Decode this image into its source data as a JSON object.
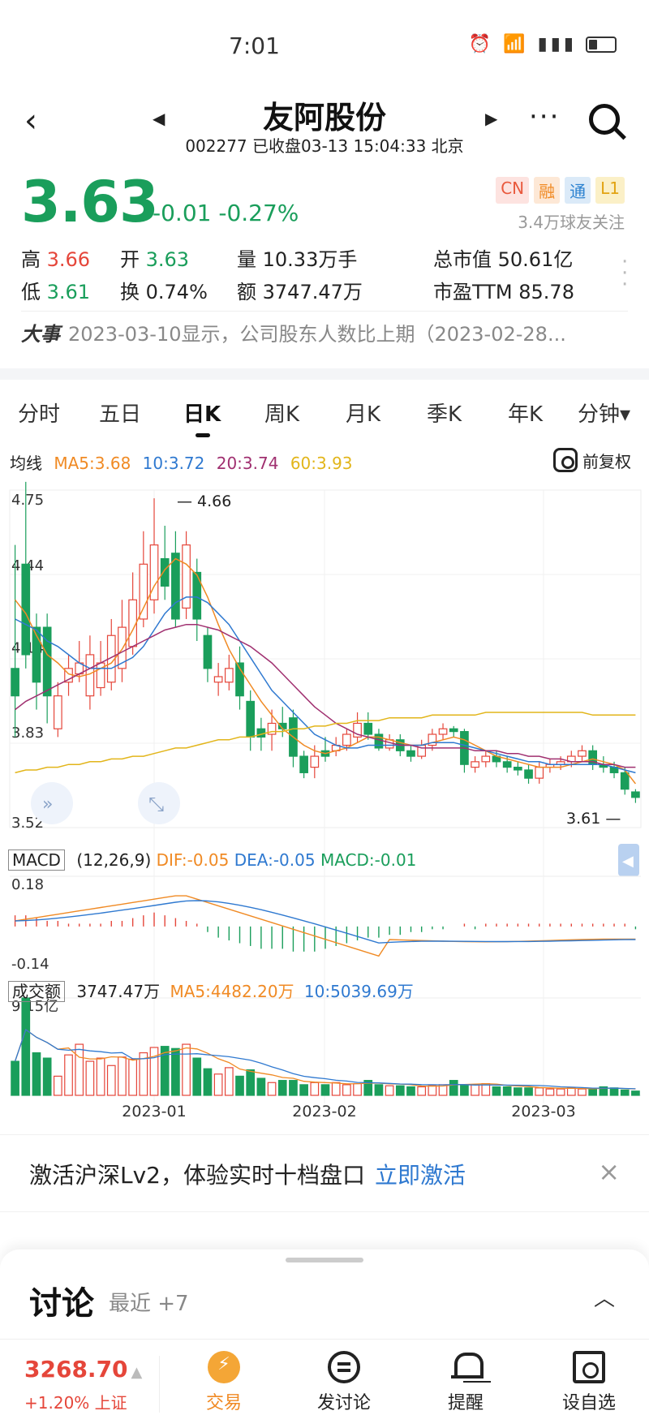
{
  "status_bar": {
    "time": "7:01",
    "icons_text": "⏰ 6 📶 4G ▮"
  },
  "nav": {
    "title": "友阿股份",
    "subtitle": "002277 已收盘03-13 15:04:33 北京",
    "more": "···"
  },
  "quote": {
    "price": "3.63",
    "change": "-0.01 -0.27%",
    "badges": [
      "CN",
      "融",
      "通",
      "L1"
    ],
    "followers": "3.4万球友关注"
  },
  "stats": [
    {
      "label": "高",
      "value": "3.66",
      "tone": "red"
    },
    {
      "label": "开",
      "value": "3.63",
      "tone": "green"
    },
    {
      "label": "量",
      "value": "10.33万手",
      "tone": "plain"
    },
    {
      "label": "总市值",
      "value": "50.61亿",
      "tone": "plain"
    },
    {
      "label": "低",
      "value": "3.61",
      "tone": "green"
    },
    {
      "label": "换",
      "value": "0.74%",
      "tone": "plain"
    },
    {
      "label": "额",
      "value": "3747.47万",
      "tone": "plain"
    },
    {
      "label": "市盈TTM",
      "value": "85.78",
      "tone": "plain"
    }
  ],
  "event": {
    "label": "大事",
    "text": "2023-03-10显示，公司股东人数比上期（2023-02-28..."
  },
  "tabs": [
    "分时",
    "五日",
    "日K",
    "周K",
    "月K",
    "季K",
    "年K",
    "分钟▾"
  ],
  "active_tab": 2,
  "ma": {
    "label": "均线",
    "items": [
      {
        "text": "MA5:3.68",
        "color": "#f08a24"
      },
      {
        "text": "10:3.72",
        "color": "#2f79d0"
      },
      {
        "text": "20:3.74",
        "color": "#a03070"
      },
      {
        "text": "60:3.93",
        "color": "#e2b51a"
      }
    ],
    "adjust": "前复权"
  },
  "macd": {
    "tag": "MACD",
    "params": "(12,26,9)",
    "dif": "DIF:-0.05",
    "dea": "DEA:-0.05",
    "macd": "MACD:-0.01",
    "ymax": "0.18",
    "ymin": "-0.14"
  },
  "volume": {
    "tag": "成交额",
    "value": "3747.47万",
    "ma5": "MA5:4482.20万",
    "ma10": "10:5039.69万",
    "ymax": "9.15亿"
  },
  "chart_data": {
    "type": "candlestick",
    "y_ticks": [
      "4.75",
      "4.44",
      "4.14",
      "3.83",
      "3.52"
    ],
    "ylim": [
      3.52,
      4.75
    ],
    "x_ticks": [
      "2023-01",
      "2023-02",
      "2023-03"
    ],
    "high_label": "4.66",
    "low_label": "3.61",
    "candles": [
      [
        4.1,
        4.0,
        4.55,
        3.85
      ],
      [
        4.48,
        4.15,
        4.78,
        4.1
      ],
      [
        4.25,
        4.05,
        4.3,
        3.95
      ],
      [
        4.25,
        4.0,
        4.3,
        3.9
      ],
      [
        3.88,
        4.0,
        4.05,
        3.85
      ],
      [
        4.05,
        4.1,
        4.15,
        4.0
      ],
      [
        4.08,
        4.12,
        4.2,
        4.05
      ],
      [
        4.0,
        4.15,
        4.22,
        3.95
      ],
      [
        4.03,
        4.12,
        4.2,
        4.0
      ],
      [
        4.05,
        4.22,
        4.28,
        4.02
      ],
      [
        4.1,
        4.25,
        4.35,
        4.05
      ],
      [
        4.18,
        4.35,
        4.45,
        4.15
      ],
      [
        4.28,
        4.48,
        4.6,
        4.25
      ],
      [
        4.35,
        4.55,
        4.72,
        4.3
      ],
      [
        4.5,
        4.4,
        4.62,
        4.35
      ],
      [
        4.52,
        4.28,
        4.6,
        4.25
      ],
      [
        4.32,
        4.55,
        4.6,
        4.28
      ],
      [
        4.45,
        4.28,
        4.5,
        4.2
      ],
      [
        4.22,
        4.1,
        4.25,
        4.05
      ],
      [
        4.05,
        4.07,
        4.12,
        4.0
      ],
      [
        4.05,
        4.1,
        4.15,
        4.02
      ],
      [
        4.12,
        4.0,
        4.18,
        3.95
      ],
      [
        3.98,
        3.85,
        4.02,
        3.8
      ],
      [
        3.88,
        3.85,
        3.92,
        3.8
      ],
      [
        3.86,
        3.9,
        3.95,
        3.8
      ],
      [
        3.9,
        3.88,
        3.96,
        3.85
      ],
      [
        3.92,
        3.78,
        3.95,
        3.74
      ],
      [
        3.78,
        3.72,
        3.8,
        3.7
      ],
      [
        3.74,
        3.78,
        3.82,
        3.7
      ],
      [
        3.8,
        3.78,
        3.85,
        3.76
      ],
      [
        3.8,
        3.82,
        3.85,
        3.78
      ],
      [
        3.82,
        3.86,
        3.88,
        3.8
      ],
      [
        3.85,
        3.9,
        3.94,
        3.83
      ],
      [
        3.9,
        3.86,
        3.94,
        3.84
      ],
      [
        3.86,
        3.81,
        3.88,
        3.8
      ],
      [
        3.81,
        3.84,
        3.86,
        3.8
      ],
      [
        3.84,
        3.8,
        3.86,
        3.78
      ],
      [
        3.8,
        3.78,
        3.82,
        3.76
      ],
      [
        3.78,
        3.82,
        3.84,
        3.77
      ],
      [
        3.82,
        3.86,
        3.88,
        3.8
      ],
      [
        3.86,
        3.88,
        3.9,
        3.84
      ],
      [
        3.88,
        3.87,
        3.89,
        3.85
      ],
      [
        3.87,
        3.75,
        3.88,
        3.72
      ],
      [
        3.74,
        3.76,
        3.78,
        3.72
      ],
      [
        3.76,
        3.78,
        3.8,
        3.74
      ],
      [
        3.78,
        3.76,
        3.8,
        3.74
      ],
      [
        3.76,
        3.74,
        3.78,
        3.72
      ],
      [
        3.74,
        3.73,
        3.76,
        3.71
      ],
      [
        3.73,
        3.7,
        3.75,
        3.68
      ],
      [
        3.7,
        3.74,
        3.76,
        3.68
      ],
      [
        3.74,
        3.75,
        3.77,
        3.72
      ],
      [
        3.75,
        3.76,
        3.78,
        3.73
      ],
      [
        3.76,
        3.78,
        3.8,
        3.74
      ],
      [
        3.78,
        3.8,
        3.82,
        3.76
      ],
      [
        3.8,
        3.75,
        3.82,
        3.73
      ],
      [
        3.75,
        3.74,
        3.78,
        3.72
      ],
      [
        3.74,
        3.72,
        3.76,
        3.7
      ],
      [
        3.72,
        3.66,
        3.74,
        3.64
      ],
      [
        3.65,
        3.63,
        3.66,
        3.61
      ]
    ],
    "ma_series": [
      {
        "name": "MA5",
        "color": "#f08a24",
        "values": [
          4.35,
          4.3,
          4.22,
          4.15,
          4.12,
          4.08,
          4.07,
          4.08,
          4.1,
          4.12,
          4.17,
          4.24,
          4.32,
          4.4,
          4.46,
          4.5,
          4.48,
          4.44,
          4.36,
          4.26,
          4.17,
          4.1,
          4.04,
          3.98,
          3.93,
          3.88,
          3.85,
          3.82,
          3.8,
          3.79,
          3.8,
          3.81,
          3.83,
          3.85,
          3.85,
          3.84,
          3.83,
          3.82,
          3.82,
          3.83,
          3.84,
          3.85,
          3.84,
          3.82,
          3.8,
          3.78,
          3.77,
          3.76,
          3.75,
          3.74,
          3.74,
          3.74,
          3.75,
          3.76,
          3.77,
          3.76,
          3.75,
          3.73,
          3.68
        ]
      },
      {
        "name": "MA10",
        "color": "#2f79d0",
        "values": [
          4.28,
          4.26,
          4.24,
          4.2,
          4.18,
          4.15,
          4.12,
          4.1,
          4.1,
          4.1,
          4.12,
          4.14,
          4.18,
          4.24,
          4.3,
          4.34,
          4.36,
          4.36,
          4.34,
          4.3,
          4.26,
          4.2,
          4.14,
          4.08,
          4.02,
          3.98,
          3.94,
          3.9,
          3.86,
          3.84,
          3.82,
          3.81,
          3.81,
          3.82,
          3.82,
          3.82,
          3.82,
          3.82,
          3.82,
          3.83,
          3.83,
          3.83,
          3.82,
          3.81,
          3.8,
          3.79,
          3.78,
          3.77,
          3.76,
          3.76,
          3.75,
          3.75,
          3.75,
          3.75,
          3.75,
          3.75,
          3.74,
          3.73,
          3.72
        ]
      },
      {
        "name": "MA20",
        "color": "#a03070",
        "values": [
          3.95,
          3.98,
          4.0,
          4.02,
          4.04,
          4.06,
          4.08,
          4.1,
          4.12,
          4.14,
          4.16,
          4.18,
          4.2,
          4.22,
          4.24,
          4.25,
          4.26,
          4.26,
          4.25,
          4.24,
          4.22,
          4.2,
          4.18,
          4.15,
          4.12,
          4.08,
          4.04,
          4.0,
          3.96,
          3.93,
          3.9,
          3.88,
          3.86,
          3.85,
          3.84,
          3.83,
          3.82,
          3.82,
          3.81,
          3.81,
          3.81,
          3.81,
          3.81,
          3.8,
          3.8,
          3.8,
          3.79,
          3.79,
          3.78,
          3.78,
          3.77,
          3.77,
          3.76,
          3.76,
          3.76,
          3.75,
          3.75,
          3.74,
          3.74
        ]
      },
      {
        "name": "MA60",
        "color": "#e2b51a",
        "values": [
          3.72,
          3.73,
          3.73,
          3.74,
          3.74,
          3.75,
          3.75,
          3.76,
          3.76,
          3.77,
          3.77,
          3.78,
          3.78,
          3.79,
          3.8,
          3.81,
          3.81,
          3.82,
          3.83,
          3.84,
          3.84,
          3.85,
          3.85,
          3.86,
          3.87,
          3.87,
          3.88,
          3.88,
          3.89,
          3.89,
          3.9,
          3.9,
          3.91,
          3.91,
          3.91,
          3.92,
          3.92,
          3.92,
          3.92,
          3.93,
          3.93,
          3.93,
          3.93,
          3.93,
          3.94,
          3.94,
          3.94,
          3.94,
          3.94,
          3.94,
          3.94,
          3.94,
          3.94,
          3.94,
          3.93,
          3.93,
          3.93,
          3.93,
          3.93
        ]
      }
    ],
    "macd_bars": [
      0.04,
      0.04,
      0.03,
      0.02,
      0.02,
      0.01,
      0.01,
      0.01,
      0.01,
      0.02,
      0.02,
      0.03,
      0.04,
      0.05,
      0.04,
      0.03,
      0.02,
      0.01,
      -0.02,
      -0.04,
      -0.05,
      -0.06,
      -0.07,
      -0.08,
      -0.08,
      -0.08,
      -0.09,
      -0.09,
      -0.09,
      -0.08,
      -0.07,
      -0.06,
      -0.05,
      -0.04,
      -0.04,
      -0.03,
      -0.03,
      -0.02,
      -0.02,
      -0.01,
      -0.01,
      0.0,
      0.01,
      -0.01,
      0.01,
      0.01,
      0.01,
      0.01,
      0.01,
      0.01,
      0.01,
      0.01,
      0.01,
      0.01,
      0.01,
      0.01,
      0.01,
      0.01,
      -0.01
    ],
    "volume_bars": [
      3.2,
      9.15,
      4.0,
      3.5,
      1.8,
      3.8,
      4.8,
      3.2,
      3.5,
      2.8,
      3.6,
      3.4,
      4.0,
      4.5,
      4.6,
      4.4,
      4.8,
      3.5,
      2.5,
      2.0,
      2.6,
      1.8,
      2.4,
      1.6,
      1.2,
      1.4,
      1.4,
      1.0,
      1.2,
      1.0,
      1.2,
      1.0,
      1.1,
      1.4,
      1.0,
      0.9,
      0.9,
      0.8,
      0.8,
      0.9,
      1.0,
      1.4,
      1.0,
      1.0,
      1.1,
      0.8,
      0.8,
      0.7,
      0.7,
      0.7,
      0.6,
      0.6,
      0.7,
      0.6,
      0.6,
      0.8,
      0.7,
      0.5,
      0.4
    ]
  },
  "banner": {
    "text": "激活沪深Lv2，体验实时十档盘口",
    "link": "立即激活",
    "close": "×"
  },
  "discuss": {
    "title": "讨论",
    "sub": "最近 +7",
    "chevron": "︿"
  },
  "bottom": {
    "index_value": "3268.70",
    "index_change": "+1.20% 上证",
    "buttons": [
      "交易",
      "发讨论",
      "提醒",
      "设自选"
    ]
  },
  "colors": {
    "up": "#e5463a",
    "down": "#1a9e5b"
  }
}
